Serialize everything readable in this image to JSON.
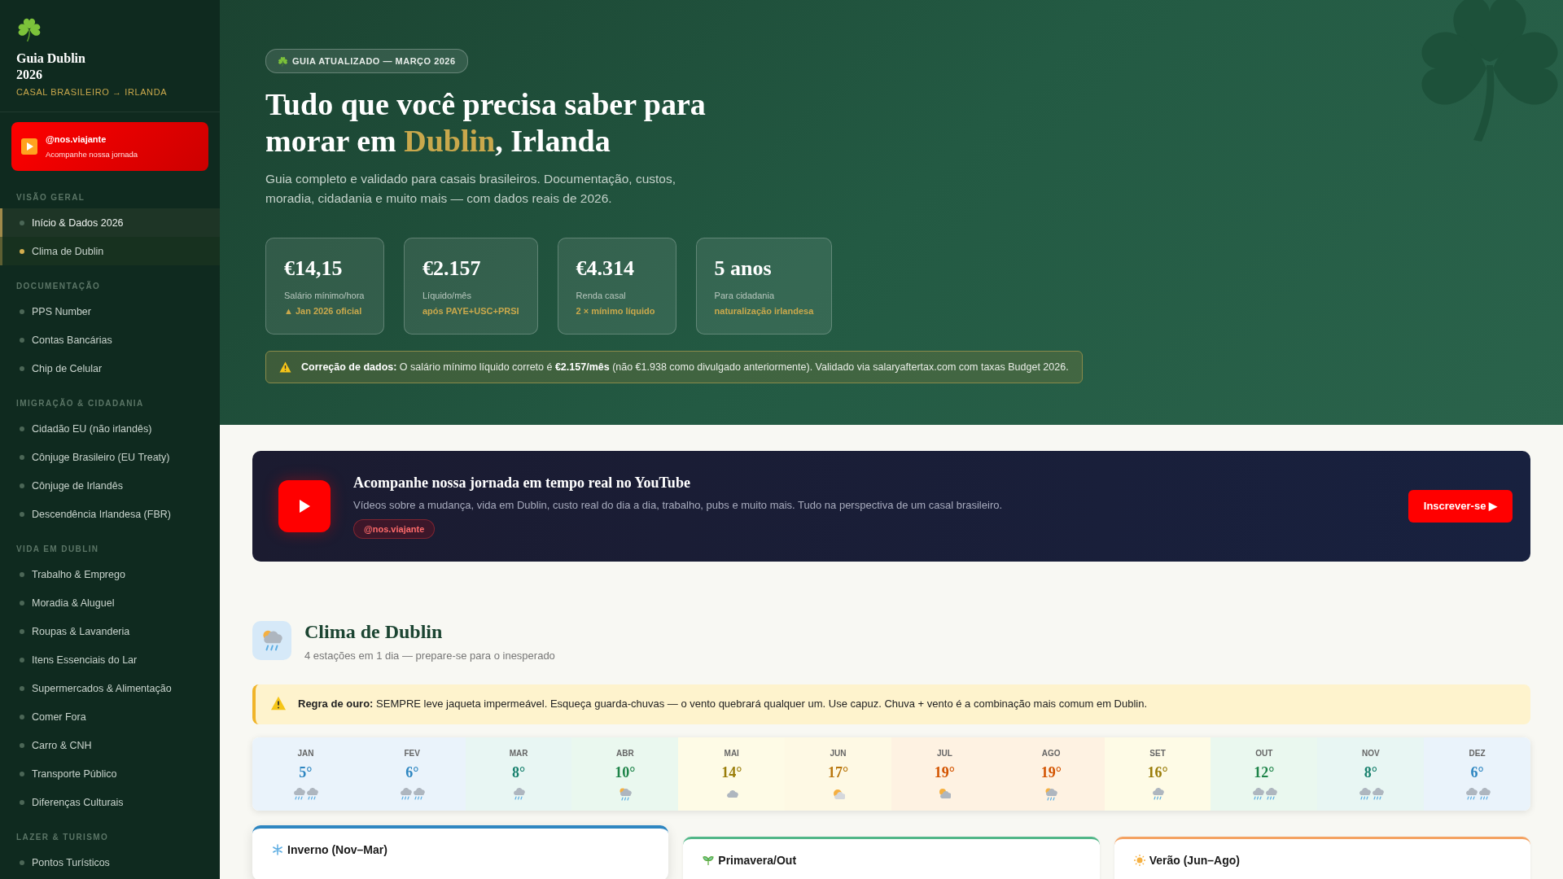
{
  "sidebar": {
    "title": "Guia Dublin 2026",
    "subtitle": "CASAL BRASILEIRO → IRLANDA",
    "channel_card": {
      "handle": "@nos.viajante",
      "caption": "Acompanhe nossa jornada"
    },
    "sections": [
      {
        "label": "VISÃO GERAL",
        "items": [
          {
            "label": "Início & Dados 2026",
            "selected": true,
            "current": false
          },
          {
            "label": "Clima de Dublin",
            "selected": false,
            "current": true
          }
        ]
      },
      {
        "label": "DOCUMENTAÇÃO",
        "items": [
          {
            "label": "PPS Number",
            "selected": false,
            "current": false
          },
          {
            "label": "Contas Bancárias",
            "selected": false,
            "current": false
          },
          {
            "label": "Chip de Celular",
            "selected": false,
            "current": false
          }
        ]
      },
      {
        "label": "IMIGRAÇÃO & CIDADANIA",
        "items": [
          {
            "label": "Cidadão EU (não irlandês)",
            "selected": false,
            "current": false
          },
          {
            "label": "Cônjuge Brasileiro (EU Treaty)",
            "selected": false,
            "current": false
          },
          {
            "label": "Cônjuge de Irlandês",
            "selected": false,
            "current": false
          },
          {
            "label": "Descendência Irlandesa (FBR)",
            "selected": false,
            "current": false
          }
        ]
      },
      {
        "label": "VIDA EM DUBLIN",
        "items": [
          {
            "label": "Trabalho & Emprego",
            "selected": false,
            "current": false
          },
          {
            "label": "Moradia & Aluguel",
            "selected": false,
            "current": false
          },
          {
            "label": "Roupas & Lavanderia",
            "selected": false,
            "current": false
          },
          {
            "label": "Itens Essenciais do Lar",
            "selected": false,
            "current": false
          },
          {
            "label": "Supermercados & Alimentação",
            "selected": false,
            "current": false
          },
          {
            "label": "Comer Fora",
            "selected": false,
            "current": false
          },
          {
            "label": "Carro & CNH",
            "selected": false,
            "current": false
          },
          {
            "label": "Transporte Público",
            "selected": false,
            "current": false
          },
          {
            "label": "Diferenças Culturais",
            "selected": false,
            "current": false
          }
        ]
      },
      {
        "label": "LAZER & TURISMO",
        "items": [
          {
            "label": "Pontos Turísticos",
            "selected": false,
            "current": false
          }
        ]
      }
    ]
  },
  "hero": {
    "badge": "GUIA ATUALIZADO — MARÇO 2026",
    "headline": {
      "before": "Tudo que você precisa saber para morar em ",
      "highlight": "Dublin",
      "after": ", Irlanda"
    },
    "lead": "Guia completo e validado para casais brasileiros. Documentação, custos, moradia, cidadania e muito mais — com dados reais de 2026.",
    "stats": [
      {
        "value": "€14,15",
        "label": "Salário mínimo/hora",
        "note": "▲ Jan 2026 oficial"
      },
      {
        "value": "€2.157",
        "label": "Líquido/mês",
        "note": "após PAYE+USC+PRSI"
      },
      {
        "value": "€4.314",
        "label": "Renda casal",
        "note": "2 × mínimo líquido"
      },
      {
        "value": "5 anos",
        "label": "Para cidadania",
        "note": "naturalização irlandesa"
      }
    ],
    "notice": "**Correção de dados:** O salário mínimo líquido correto é **€2.157/mês** (não €1.938 como divulgado anteriormente). Validado via salaryaftertax.com com taxas Budget 2026."
  },
  "youtube_banner": {
    "title": "Acompanhe nossa jornada em tempo real no YouTube",
    "text": "Vídeos sobre a mudança, vida em Dublin, custo real do dia a dia, trabalho, pubs e muito mais. Tudo na perspectiva de um casal brasileiro.",
    "handle": "@nos.viajante",
    "button": "Inscrever-se ▶"
  },
  "climate": {
    "title": "Clima de Dublin",
    "subtitle": "4 estações em 1 dia — prepare-se para o inesperado",
    "rule": "**Regra de ouro:** SEMPRE leve jaqueta impermeável. Esqueça guarda-chuvas — o vento quebrará qualquer um. Use capuz. Chuva + vento é a combinação mais comum em Dublin.",
    "months": [
      {
        "month": "JAN",
        "temp": "5°",
        "color": "#2e86c1",
        "kind": "heavy-rain"
      },
      {
        "month": "FEV",
        "temp": "6°",
        "color": "#2e86c1",
        "kind": "heavy-rain"
      },
      {
        "month": "MAR",
        "temp": "8°",
        "color": "#17806d",
        "kind": "rain"
      },
      {
        "month": "ABR",
        "temp": "10°",
        "color": "#1e8449",
        "kind": "showers"
      },
      {
        "month": "MAI",
        "temp": "14°",
        "color": "#9a7d0a",
        "kind": "cloud"
      },
      {
        "month": "JUN",
        "temp": "17°",
        "color": "#b9770e",
        "kind": "sun-cloud"
      },
      {
        "month": "JUL",
        "temp": "19°",
        "color": "#d35400",
        "kind": "partly-cloudy"
      },
      {
        "month": "AGO",
        "temp": "19°",
        "color": "#d35400",
        "kind": "showers"
      },
      {
        "month": "SET",
        "temp": "16°",
        "color": "#9a7d0a",
        "kind": "rain"
      },
      {
        "month": "OUT",
        "temp": "12°",
        "color": "#1e8449",
        "kind": "heavy-rain"
      },
      {
        "month": "NOV",
        "temp": "8°",
        "color": "#17806d",
        "kind": "heavy-rain"
      },
      {
        "month": "DEZ",
        "temp": "6°",
        "color": "#2e86c1",
        "kind": "heavy-rain"
      }
    ],
    "seasons": [
      {
        "title": "Inverno (Nov–Mar)",
        "kind": "snowflake",
        "color": "#2e86c1",
        "raised": true
      },
      {
        "title": "Primavera/Out",
        "kind": "sprout",
        "color": "#52b788",
        "raised": false
      },
      {
        "title": "Verão (Jun–Ago)",
        "kind": "sun",
        "color": "#f4a261",
        "raised": false
      }
    ]
  }
}
